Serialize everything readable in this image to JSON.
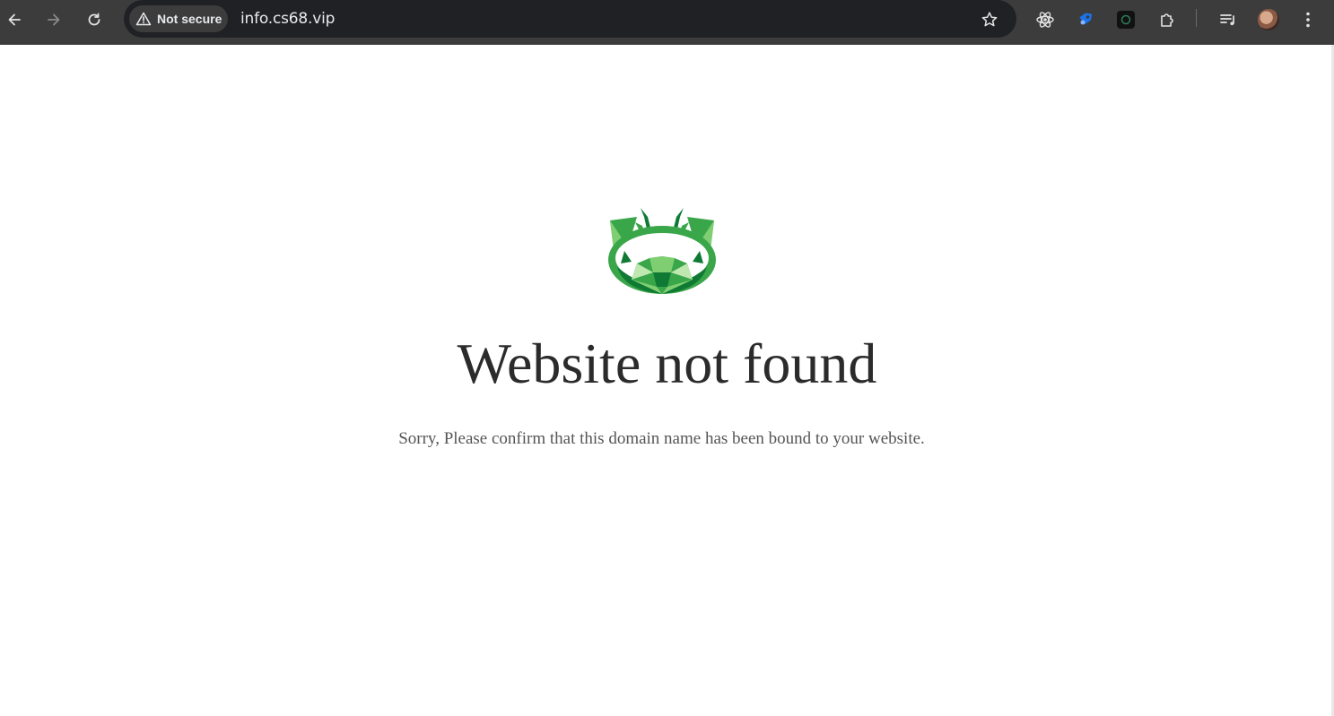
{
  "browser": {
    "security_chip": "Not secure",
    "url": "info.cs68.vip",
    "icons": {
      "back": "arrow-left",
      "forward": "arrow-right",
      "reload": "reload",
      "warning": "warning-triangle",
      "bookmark": "star",
      "extension_react": "react-atom",
      "extension_blue": "blue-tag",
      "extension_dark": "dark-circle",
      "extensions": "puzzle",
      "reading_list": "reading-list",
      "profile": "avatar",
      "menu": "three-dots"
    },
    "toolbar_color": "#3c3c3c",
    "omnibox_color": "#202124"
  },
  "page": {
    "heading": "Website not found",
    "message": "Sorry, Please confirm that this domain name has been bound to your website.",
    "logo_colors": [
      "#0f7a33",
      "#3aa64a",
      "#7fcf72",
      "#bfe8b0"
    ]
  }
}
